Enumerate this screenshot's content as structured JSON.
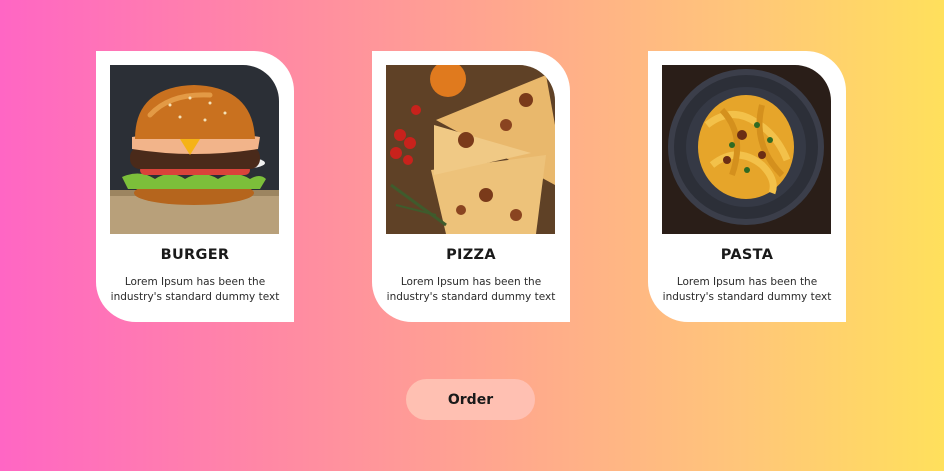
{
  "cards": [
    {
      "title": "BURGER",
      "description": "Lorem Ipsum has been the industry's standard dummy text",
      "image": "burger-photo"
    },
    {
      "title": "PIZZA",
      "description": "Lorem Ipsum has been the industry's standard dummy text",
      "image": "pizza-photo"
    },
    {
      "title": "PASTA",
      "description": "Lorem Ipsum has been the industry's standard dummy text",
      "image": "pasta-photo"
    }
  ],
  "order_button": {
    "label": "Order"
  },
  "colors": {
    "background_gradient": [
      "#ff66c4",
      "#ffe05c"
    ],
    "card": "#ffffff",
    "button": "#ffc0b2"
  }
}
